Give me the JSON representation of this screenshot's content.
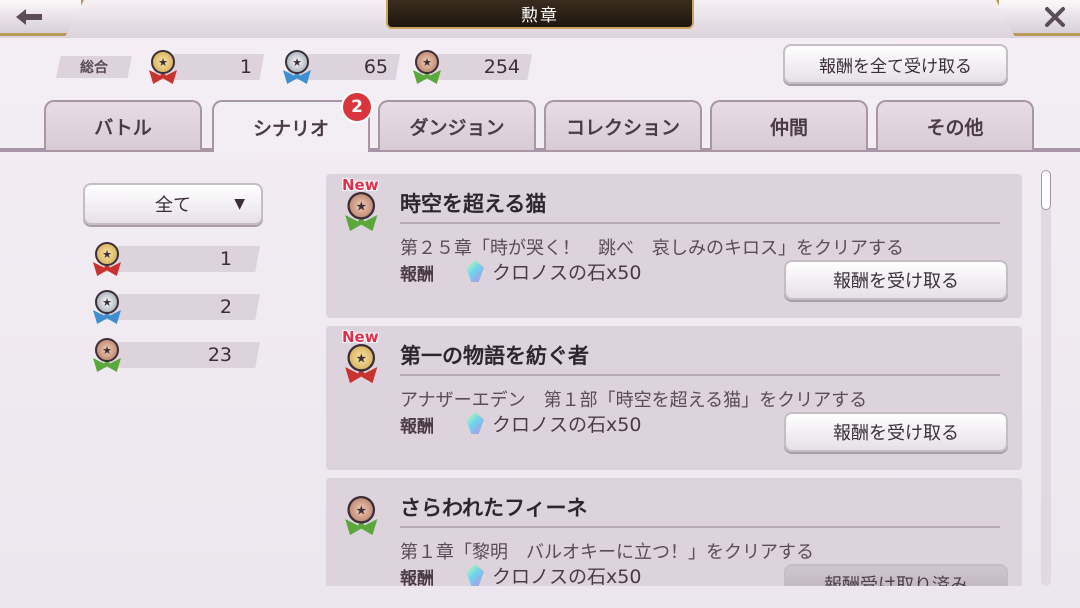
{
  "header": {
    "title": "勲章",
    "back_icon": "arrow-left-icon",
    "close_icon": "close-icon"
  },
  "stats": {
    "total_label": "総合",
    "gold": "1",
    "silver": "65",
    "bronze": "254"
  },
  "claim_all_label": "報酬を全て受け取る",
  "tabs": [
    {
      "label": "バトル"
    },
    {
      "label": "シナリオ"
    },
    {
      "label": "ダンジョン"
    },
    {
      "label": "コレクション"
    },
    {
      "label": "仲間"
    },
    {
      "label": "その他"
    }
  ],
  "active_tab": "シナリオ",
  "tab_badge": "2",
  "filter": {
    "selected": "全て",
    "arrow": "▼"
  },
  "sidebar_counts": {
    "gold": "1",
    "silver": "2",
    "bronze": "23"
  },
  "achievements": [
    {
      "new_label": "New",
      "title": "時空を超える猫",
      "description": "第２５章「時が哭く！　跳べ　哀しみのキロス」をクリアする",
      "reward_label": "報酬",
      "reward": "クロノスの石x50",
      "button": "報酬を受け取る"
    },
    {
      "new_label": "New",
      "title": "第一の物語を紡ぐ者",
      "description": "アナザーエデン　第１部「時空を超える猫」をクリアする",
      "reward_label": "報酬",
      "reward": "クロノスの石x50",
      "button": "報酬を受け取る"
    },
    {
      "new_label": "",
      "title": "さらわれたフィーネ",
      "description": "第１章「黎明　バルオキーに立つ！」をクリアする",
      "reward_label": "報酬",
      "reward": "クロノスの石x50",
      "button": "報酬受け取り済み"
    }
  ],
  "colors": {
    "badge": "#d9353f",
    "new_text": "#e02f4e",
    "title_plate": "#1d150e",
    "gold_trim": "#c9a45c"
  }
}
